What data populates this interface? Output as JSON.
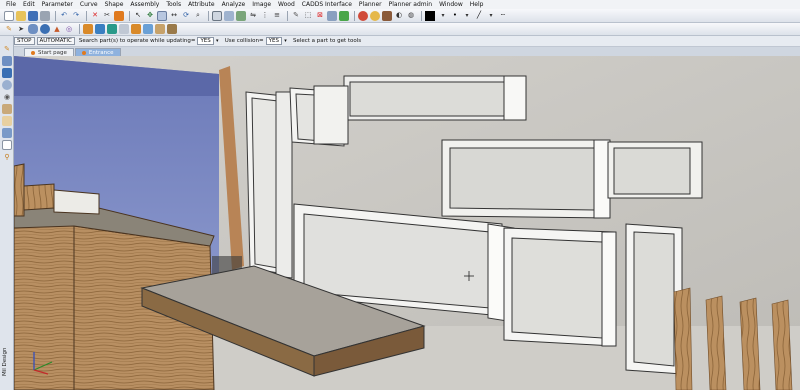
{
  "menu": [
    "File",
    "Edit",
    "Parameter",
    "Curve",
    "Shape",
    "Assembly",
    "Tools",
    "Attribute",
    "Analyze",
    "Image",
    "Wood",
    "CADDS Interface",
    "Planner",
    "Planner admin",
    "Window",
    "Help"
  ],
  "options": {
    "stop_label": "STOP",
    "automatic_label": "AUTOMATIC",
    "search_label": "Search part(s) to operate while updating=",
    "search_value": "YES",
    "collision_label": "Use collision=",
    "collision_value": "YES",
    "hint": "Select a part to get tools"
  },
  "tabs": [
    {
      "label": "Start page",
      "active": false
    },
    {
      "label": "Entrance",
      "active": true
    }
  ],
  "side_panel_label": "Mil Design",
  "colors": {
    "accent": "#8fb2de",
    "active_tab": "#8fb2de",
    "wall": "#c9c7c2",
    "cabinet": "#f4f4f2",
    "wood": "#b28a5e",
    "floor_blue": "#5a6aa6"
  },
  "toolbar_icons": [
    "new-icon",
    "open-icon",
    "save-icon",
    "print-icon",
    "undo-icon",
    "redo-icon",
    "delete-icon",
    "cut-icon",
    "paint-icon",
    "box-icon",
    "sphere-icon",
    "cylinder-icon",
    "magic-icon",
    "render-icon",
    "grid-icon",
    "select-icon",
    "snap-icon",
    "color-icon",
    "line-style-icon"
  ]
}
